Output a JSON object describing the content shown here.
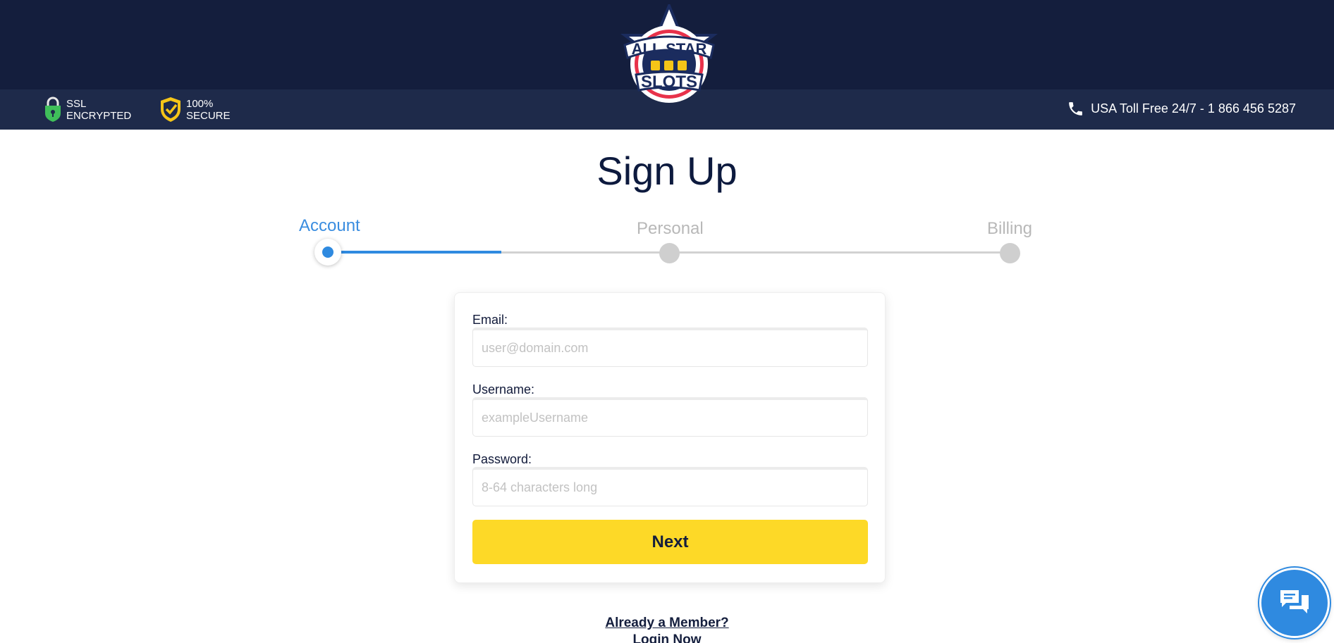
{
  "header": {
    "logo": {
      "line1": "ALL STAR",
      "line2": "SLOTS",
      "colors": {
        "red": "#e8324a",
        "navy": "#1b2c5e",
        "gold": "#f5c518"
      }
    },
    "badges": [
      {
        "icon": "lock-shield-icon",
        "line1": "SSL",
        "line2": "ENCRYPTED",
        "color": "#3fbf5a"
      },
      {
        "icon": "check-shield-icon",
        "line1": "100%",
        "line2": "SECURE",
        "color": "#f5c518"
      }
    ],
    "phone": {
      "icon": "phone-icon",
      "text": "USA Toll Free 24/7 - 1 866 456 5287"
    }
  },
  "page": {
    "title": "Sign Up"
  },
  "stepper": {
    "steps": [
      {
        "label": "Account",
        "state": "active"
      },
      {
        "label": "Personal",
        "state": "inactive"
      },
      {
        "label": "Billing",
        "state": "inactive"
      }
    ],
    "colors": {
      "active": "#2f8ae0",
      "inactive": "#cfcfcf"
    }
  },
  "form": {
    "email": {
      "label": "Email:",
      "placeholder": "user@domain.com",
      "value": ""
    },
    "username": {
      "label": "Username:",
      "placeholder": "exampleUsername",
      "value": ""
    },
    "password": {
      "label": "Password:",
      "placeholder": "8-64 characters long",
      "value": ""
    },
    "next_label": "Next",
    "button_color": "#fdd927"
  },
  "footer": {
    "already_member": "Already a Member?",
    "login": "Login Now"
  },
  "chat": {
    "icon": "chat-bubbles-icon"
  },
  "theme": {
    "topbar": "#141e3d",
    "subbar": "#1e2a4a"
  }
}
